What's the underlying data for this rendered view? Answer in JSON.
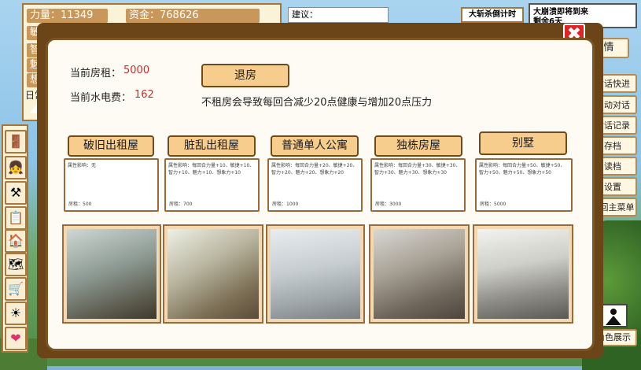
{
  "stats": {
    "strength": "力量：11349",
    "money": "资金：768626",
    "agility": "敏",
    "intelligence": "智力",
    "charm": "魅力",
    "imagination": "想象",
    "daily": "日常"
  },
  "top_bar": {
    "suggestion_label": "建议：",
    "countdown_label": "大斩杀倒计时",
    "collapse_notice_line1": "大崩溃即将到来",
    "collapse_notice_line2": "剩余6天"
  },
  "right_menu": {
    "partial_button": "情",
    "items": [
      "对话快进",
      "自动对话",
      "对话记录",
      "存档",
      "读档",
      "设置",
      "返回主菜单"
    ],
    "character_display": "角色展示"
  },
  "left_icons": [
    "door-icon",
    "portrait-icon",
    "tools-icon",
    "notepad-icon",
    "house-icon",
    "map-icon",
    "cart-icon",
    "sun-icon",
    "heart-icon"
  ],
  "modal": {
    "rent_label": "当前房租：",
    "rent_value": "5000",
    "utility_label": "当前水电费：",
    "utility_value": "162",
    "checkout_label": "退房",
    "warning": "不租房会导致每回合减少20点健康与增加20点压力",
    "options": [
      {
        "name": "破旧出租屋",
        "effect": "属性影响：无",
        "rent": "房租：500"
      },
      {
        "name": "脏乱出租屋",
        "effect": "属性影响：每回合力量+10、敏捷+10、智力+10、魅力+10、想象力+10",
        "rent": "房租：700"
      },
      {
        "name": "普通单人公寓",
        "effect": "属性影响：每回合力量+20、敏捷+20、智力+20、魅力+20、想象力+20",
        "rent": "房租：1000"
      },
      {
        "name": "独栋房屋",
        "effect": "属性影响：每回合力量+30、敏捷+30、智力+30、魅力+30、想象力+30",
        "rent": "房租：3000"
      },
      {
        "name": "别墅",
        "effect": "属性影响：每回合力量+50、敏捷+50、智力+50、魅力+50、想象力+50",
        "rent": "房租：5000"
      }
    ]
  },
  "colors": {
    "frame_brown": "#6b4418",
    "button_tan": "#f7cd8e",
    "value_red": "#d62828",
    "close_red": "#e02424"
  }
}
